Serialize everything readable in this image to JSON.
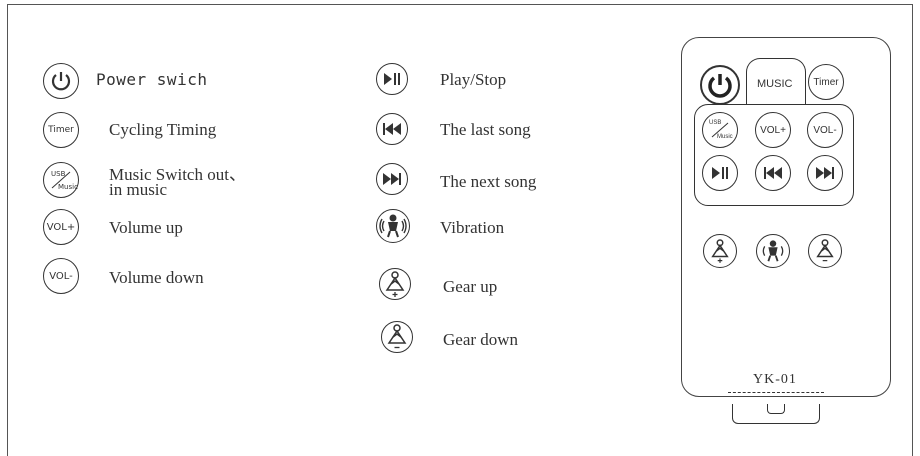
{
  "legend_left": [
    {
      "icon": "power-icon",
      "label": "Power swich"
    },
    {
      "icon": "timer-icon",
      "icon_text": "Timer",
      "label": "Cycling Timing"
    },
    {
      "icon": "usb-music-icon",
      "icon_text_top": "USB",
      "icon_text_bottom": "Music",
      "label_line1": "Music Switch out、",
      "label_line2": "in music"
    },
    {
      "icon": "volume-up-icon",
      "icon_text": "VOL+",
      "label": "Volume up"
    },
    {
      "icon": "volume-down-icon",
      "icon_text": "VOL-",
      "label": "Volume down"
    }
  ],
  "legend_mid": [
    {
      "icon": "play-pause-icon",
      "label": "Play/Stop"
    },
    {
      "icon": "previous-track-icon",
      "label": "The last song"
    },
    {
      "icon": "next-track-icon",
      "label": "The next song"
    },
    {
      "icon": "vibration-icon",
      "label": "Vibration"
    },
    {
      "icon": "gear-up-icon",
      "label": "Gear up"
    },
    {
      "icon": "gear-down-icon",
      "label": "Gear down"
    }
  ],
  "remote": {
    "music_label": "MUSIC",
    "timer_label": "Timer",
    "vol_plus_label": "VOL+",
    "vol_minus_label": "VOL-",
    "usb_label": "USB",
    "music_small_label": "Music",
    "model": "YK-01"
  }
}
